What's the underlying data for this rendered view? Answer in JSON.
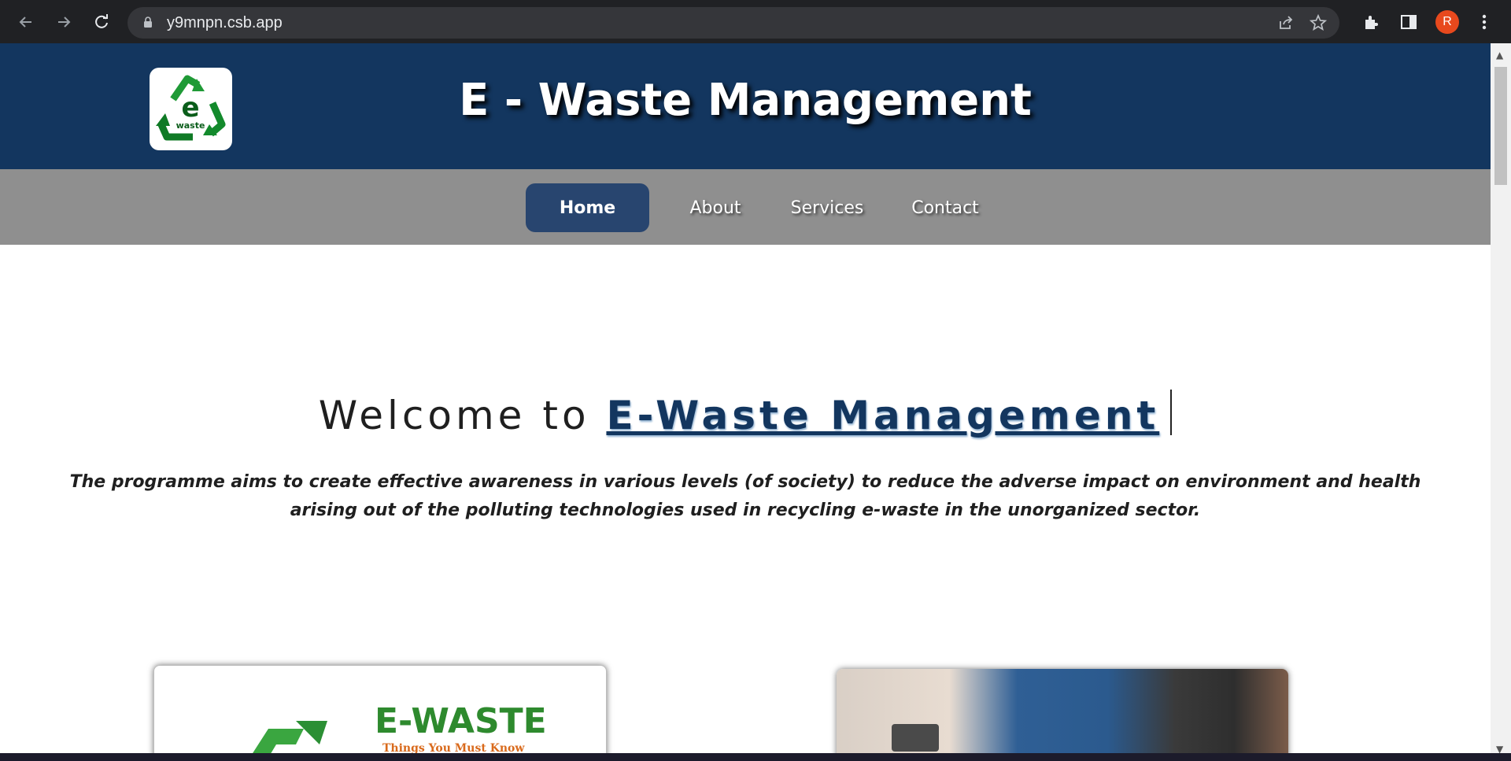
{
  "browser": {
    "url": "y9mnpn.csb.app",
    "profile_initial": "R"
  },
  "site": {
    "title": "E - Waste Management",
    "logo_text": "waste",
    "logo_letter": "e"
  },
  "menu": {
    "items": [
      {
        "label": "Home",
        "active": true
      },
      {
        "label": "About"
      },
      {
        "label": "Services"
      },
      {
        "label": "Contact"
      }
    ]
  },
  "hero": {
    "welcome_prefix": "Welcome to",
    "welcome_brand": "E-Waste Management",
    "tagline": "The programme aims to create effective awareness in various levels (of society) to reduce the adverse impact on environment and health arising out of the polluting technologies used in recycling e-waste in the unorganized sector."
  },
  "cards": {
    "left": {
      "title": "E-WASTE",
      "subtitle": "Things You Must Know"
    }
  },
  "colors": {
    "header_bg": "#13365f",
    "menu_bg": "#8f8f8f",
    "active_tab": "#28456f",
    "brand_green": "#2e8a2e"
  }
}
